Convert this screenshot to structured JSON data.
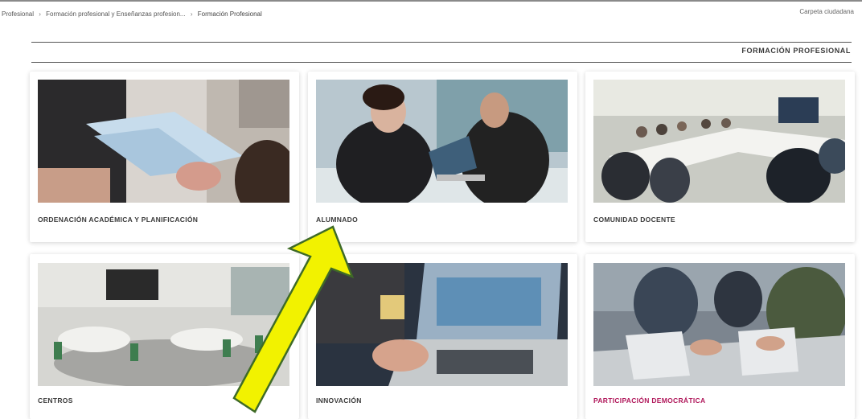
{
  "breadcrumb": {
    "items": [
      "Profesional",
      "Formación profesional y Enseñanzas profesion...",
      "Formación Profesional"
    ]
  },
  "header": {
    "carpeta_label": "Carpeta ciudadana"
  },
  "section": {
    "title": "FORMACIÓN PROFESIONAL"
  },
  "cards": [
    {
      "label": "ORDENACIÓN ACADÉMICA Y PLANIFICACIÓN",
      "image": "documents-handoff-photo"
    },
    {
      "label": "ALUMNADO",
      "image": "students-laptop-photo"
    },
    {
      "label": "COMUNIDAD DOCENTE",
      "image": "teachers-meeting-photo"
    },
    {
      "label": "CENTROS",
      "image": "classroom-photo"
    },
    {
      "label": "INNOVACIÓN",
      "image": "laptop-typing-photo"
    },
    {
      "label": "PARTICIPACIÓN DEMOCRÁTICA",
      "image": "voting-photo"
    }
  ],
  "colors": {
    "accent_label": "#b0175a",
    "arrow_fill": "#f2f200",
    "arrow_stroke": "#3f6b27"
  },
  "annotation": {
    "type": "arrow",
    "color": "yellow",
    "points_to": "ALUMNADO"
  }
}
